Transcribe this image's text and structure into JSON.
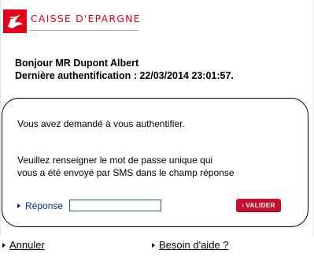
{
  "brand": {
    "name": "CAISSE D'EPARGNE",
    "color": "#e2001a"
  },
  "greeting": {
    "line1": "Bonjour MR  Dupont Albert",
    "line2": "Dernière authentification : 22/03/2014 23:01:57."
  },
  "panel": {
    "intro": "Vous avez demandé à vous authentifier.",
    "instructions_line1": "Veuillez renseigner le mot de passe unique qui",
    "instructions_line2": "vous a été envoyé par SMS dans le champ réponse",
    "response_label": "Réponse",
    "response_value": "",
    "submit_label": "VALIDER"
  },
  "footer": {
    "cancel_label": "Annuler",
    "help_label": "Besoin d'aide ?"
  }
}
